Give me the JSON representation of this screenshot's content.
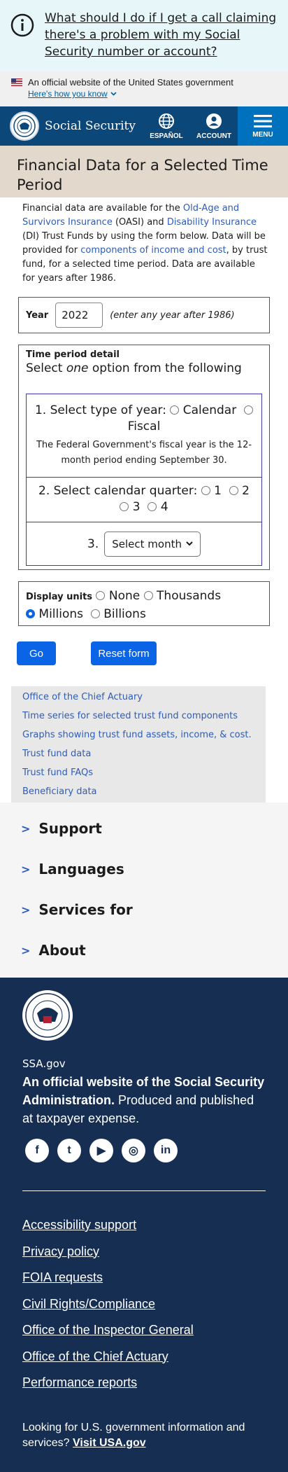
{
  "alert": {
    "link": "What should I do if I get a call claiming there's a problem with my Social Security number or account?"
  },
  "gov_banner": {
    "text": "An official website of the United States government",
    "howto": "Here's how you know"
  },
  "header": {
    "brand": "Social Security",
    "espanol": "ESPAÑOL",
    "account": "ACCOUNT",
    "menu": "MENU"
  },
  "page": {
    "title": "Financial Data for a Selected Time Period"
  },
  "intro": {
    "t1": "Financial data are available for the ",
    "link_oasi": "Old-Age and Survivors Insurance",
    "t2": " (OASI) and ",
    "link_di": "Disability Insurance",
    "t3": " (DI) Trust Funds by using the form below. Data will be provided for ",
    "link_components": "components of income and cost",
    "t4": ", by trust fund, for a selected time period. Data are available for years after 1986."
  },
  "form": {
    "year_label": "Year",
    "year_value": "2022",
    "year_hint": "(enter any year after 1986)",
    "tp_legend": "Time period detail",
    "tp_sub_pre": "Select ",
    "tp_sub_em": "one",
    "tp_sub_post": " option from the following",
    "type_label": "1. Select type of year:",
    "calendar": "Calendar",
    "fiscal": "Fiscal",
    "fy_note": "The Federal Government's fiscal year is the 12-month period ending September 30.",
    "quarter_label": "2. Select calendar quarter:",
    "q1": "1",
    "q2": "2",
    "q3": "3",
    "q4": "4",
    "month_num": "3.",
    "month_select": "Select month",
    "units_label": "Display units",
    "u_none": "None",
    "u_thousands": "Thousands",
    "u_millions": "Millions",
    "u_billions": "Billions",
    "go": "Go",
    "reset": "Reset form"
  },
  "related": [
    "Office of the Chief Actuary",
    "Time series for selected trust fund components",
    "Graphs showing trust fund assets, income, & cost.",
    "Trust fund data",
    "Trust fund FAQs",
    "Beneficiary data"
  ],
  "accordion": [
    "Support",
    "Languages",
    "Services for",
    "About"
  ],
  "footer": {
    "site": "SSA.gov",
    "official_bold": "An official website of the Social Security Administration.",
    "official_rest": " Produced and published at taxpayer expense.",
    "links": [
      "Accessibility support",
      "Privacy policy",
      "FOIA requests",
      "Civil Rights/Compliance",
      "Office of the Inspector General",
      "Office of the Chief Actuary",
      "Performance reports"
    ],
    "usa_text": "Looking for U.S. government information and services? ",
    "usa_link": "Visit USA.gov"
  },
  "icons": {
    "facebook": "f",
    "twitter": "t",
    "youtube": "▶",
    "instagram": "◎",
    "linkedin": "in"
  },
  "colors": {
    "header": "#0b4778",
    "accent": "#0b63e6",
    "footer": "#162e51",
    "title_band": "#e3d8cc"
  }
}
